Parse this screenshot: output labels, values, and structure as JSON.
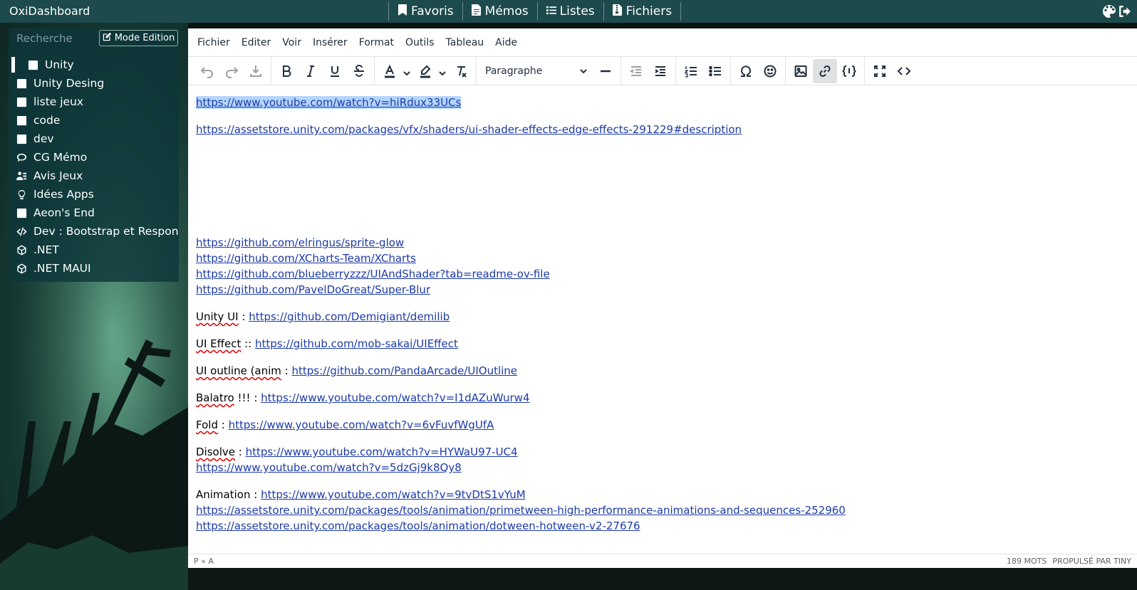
{
  "app": {
    "brand": "OxiDashboard"
  },
  "topnav": [
    {
      "label": "Favoris",
      "icon": "bookmark-icon"
    },
    {
      "label": "Mémos",
      "icon": "file-icon"
    },
    {
      "label": "Listes",
      "icon": "list-icon"
    },
    {
      "label": "Fichiers",
      "icon": "file-zip-icon"
    }
  ],
  "search": {
    "placeholder": "Recherche",
    "mode_button": "Mode Edition"
  },
  "sidebar": {
    "items": [
      {
        "label": "Unity",
        "icon": "square-icon",
        "active": true
      },
      {
        "label": "Unity Desing",
        "icon": "square-icon"
      },
      {
        "label": "liste jeux",
        "icon": "square-icon"
      },
      {
        "label": "code",
        "icon": "square-icon"
      },
      {
        "label": "dev",
        "icon": "square-icon"
      },
      {
        "label": "CG Mémo",
        "icon": "chat-icon"
      },
      {
        "label": "Avis Jeux",
        "icon": "people-icon"
      },
      {
        "label": "Idées Apps",
        "icon": "lightbulb-icon"
      },
      {
        "label": "Aeon's End",
        "icon": "square-icon"
      },
      {
        "label": "Dev : Bootstrap et Respon",
        "icon": "code-icon"
      },
      {
        "label": ".NET",
        "icon": "codesandbox-icon"
      },
      {
        "label": ".NET MAUI",
        "icon": "codesandbox-icon"
      }
    ]
  },
  "editor": {
    "menu": [
      "Fichier",
      "Editer",
      "Voir",
      "Insérer",
      "Format",
      "Outils",
      "Tableau",
      "Aide"
    ],
    "block_format": "Paragraphe",
    "content": {
      "link1": "https://www.youtube.com/watch?v=hiRdux33UCs",
      "link2": "https://assetstore.unity.com/packages/vfx/shaders/ui-shader-effects-edge-effects-291229#description",
      "gh1": "https://github.com/elringus/sprite-glow",
      "gh2": "https://github.com/XCharts-Team/XCharts",
      "gh3": "https://github.com/blueberryzzz/UIAndShader?tab=readme-ov-file",
      "gh4": "https://github.com/PavelDoGreat/Super-Blur",
      "unityui_label": "Unity UI",
      "unityui_sep": " : ",
      "unityui_link": "https://github.com/Demigiant/demilib",
      "uieffect_label": "UI Effect",
      "uieffect_sep": " :: ",
      "uieffect_link": "https://github.com/mob-sakai/UIEffect",
      "outline_label": "UI outline (anim",
      "outline_sep": " : ",
      "outline_link": "https://github.com/PandaArcade/UIOutline",
      "balatro_label": "Balatro",
      "balatro_sep": " !!! : ",
      "balatro_link": "https://www.youtube.com/watch?v=I1dAZuWurw4",
      "fold_label": "Fold",
      "fold_sep": " : ",
      "fold_link": "https://www.youtube.com/watch?v=6vFuvfWgUfA",
      "disolve_label": "Disolve",
      "disolve_sep": " : ",
      "disolve_link1": "https://www.youtube.com/watch?v=HYWaU97-UC4",
      "disolve_link2": "https://www.youtube.com/watch?v=5dzGj9k8Qy8",
      "anim_label": "Animation : ",
      "anim_link1": "https://www.youtube.com/watch?v=9tvDtS1vYuM",
      "anim_link2": "https://assetstore.unity.com/packages/tools/animation/primetween-high-performance-animations-and-sequences-252960",
      "anim_link3": "https://assetstore.unity.com/packages/tools/animation/dotween-hotween-v2-27676"
    },
    "status": {
      "path": "P » A",
      "words": "189 MOTS",
      "powered": "PROPULSÉ PAR TINY"
    }
  },
  "colors": {
    "topbar": "#1d4a4d",
    "sidebar": "#0e373a",
    "link": "#1c3aa9",
    "selection": "#b4d5fe"
  }
}
